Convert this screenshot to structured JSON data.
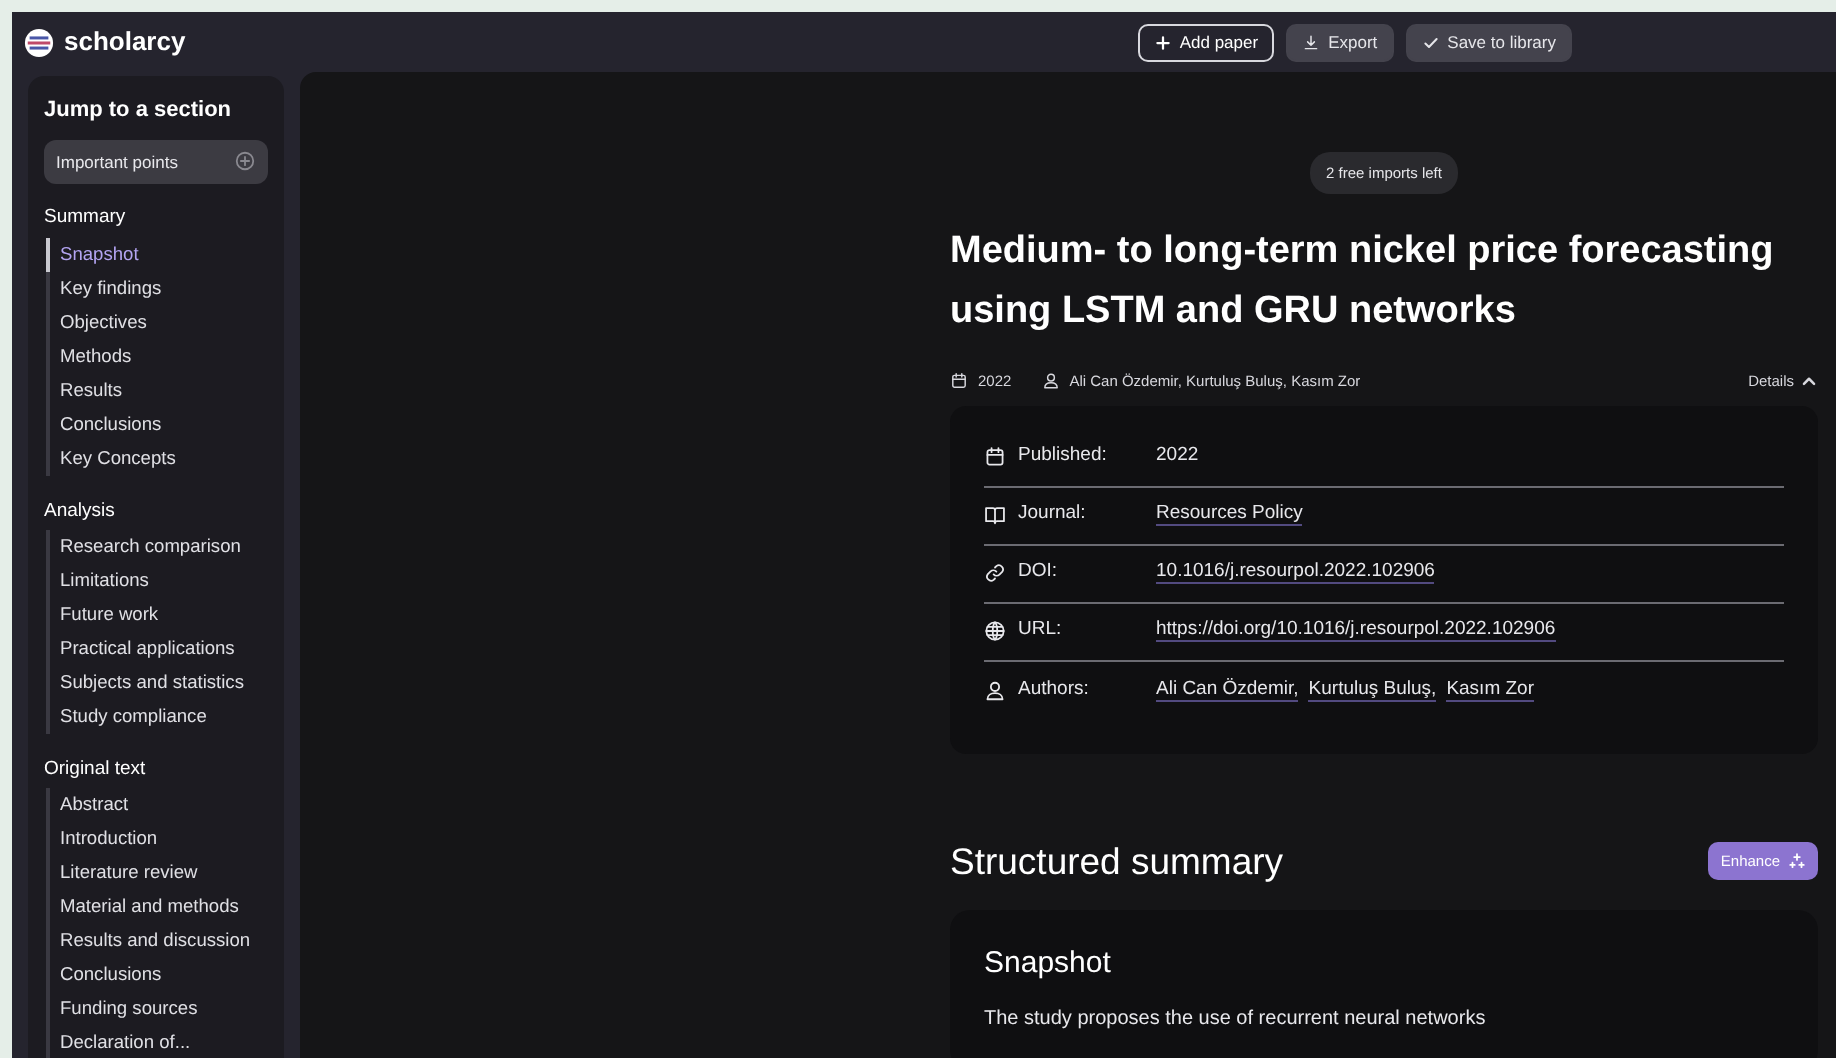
{
  "app": {
    "name": "scholarcy"
  },
  "toolbar": [
    {
      "label": "Add paper",
      "kind": "outline"
    },
    {
      "label": "Export",
      "kind": "filled"
    },
    {
      "label": "Save to library",
      "kind": "filled"
    }
  ],
  "sidebar": {
    "title": "Jump to a section",
    "important_button": "Important points",
    "sections": [
      {
        "title": "Summary",
        "items": [
          {
            "label": "Snapshot",
            "selected": true
          },
          {
            "label": "Key findings",
            "selected": false
          },
          {
            "label": "Objectives",
            "selected": false
          },
          {
            "label": "Methods",
            "selected": false
          },
          {
            "label": "Results",
            "selected": false
          },
          {
            "label": "Conclusions",
            "selected": false
          },
          {
            "label": "Key Concepts",
            "selected": false
          }
        ]
      },
      {
        "title": "Analysis",
        "items": [
          {
            "label": "Research comparison",
            "selected": false
          },
          {
            "label": "Limitations",
            "selected": false
          },
          {
            "label": "Future work",
            "selected": false
          },
          {
            "label": "Practical applications",
            "selected": false
          },
          {
            "label": "Subjects and statistics",
            "selected": false
          },
          {
            "label": "Study compliance",
            "selected": false
          }
        ]
      },
      {
        "title": "Original text",
        "items": [
          {
            "label": "Abstract",
            "selected": false
          },
          {
            "label": "Introduction",
            "selected": false
          },
          {
            "label": "Literature review",
            "selected": false
          },
          {
            "label": "Material and methods",
            "selected": false
          },
          {
            "label": "Results and discussion",
            "selected": false
          },
          {
            "label": "Conclusions",
            "selected": false
          },
          {
            "label": "Funding sources",
            "selected": false
          },
          {
            "label": "Declaration of...",
            "selected": false
          }
        ]
      }
    ]
  },
  "paper": {
    "imports_badge": "2 free imports left",
    "title": "Medium- to long-term nickel price forecasting using LSTM and GRU networks",
    "year": "2022",
    "authors": "Ali Can Özdemir, Kurtuluş Buluş, Kasım Zor",
    "details_toggle": {
      "label": "Details",
      "expanded": true
    },
    "details": [
      {
        "label": "Published:",
        "kind": "text",
        "values": [
          "2022"
        ]
      },
      {
        "label": "Journal:",
        "kind": "link",
        "values": [
          "Resources Policy"
        ]
      },
      {
        "label": "DOI:",
        "kind": "link",
        "values": [
          "10.1016/j.resourpol.2022.102906"
        ]
      },
      {
        "label": "URL:",
        "kind": "link",
        "values": [
          "https://doi.org/10.1016/j.resourpol.2022.102906"
        ]
      },
      {
        "label": "Authors:",
        "kind": "link",
        "values": [
          "Ali Can Özdemir,",
          "Kurtuluş Buluş,",
          "Kasım Zor"
        ]
      }
    ]
  },
  "summary": {
    "title": "Structured summary",
    "enhance_button": "Enhance",
    "card_title": "Snapshot",
    "text": "The study proposes the use of recurrent neural networks"
  }
}
